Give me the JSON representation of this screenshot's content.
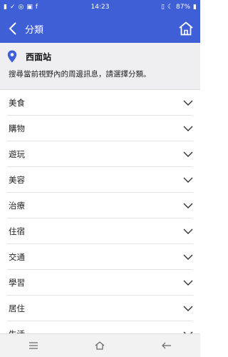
{
  "status_bar": {
    "time": "14:23",
    "battery": "87%",
    "icons_left": [
      "signal-icon",
      "check-icon",
      "wifi-icon",
      "photo-icon",
      "facebook-icon"
    ],
    "icons_right": [
      "vibrate-icon",
      "moon-icon",
      "battery-icon"
    ]
  },
  "app_bar": {
    "title": "分類"
  },
  "location": {
    "station": "西面站",
    "instruction": "搜尋當前視野內的周邊訊息，請選擇分類。"
  },
  "categories": [
    {
      "label": "美食"
    },
    {
      "label": "購物"
    },
    {
      "label": "遊玩"
    },
    {
      "label": "美容"
    },
    {
      "label": "治療"
    },
    {
      "label": "住宿"
    },
    {
      "label": "交通"
    },
    {
      "label": "學習"
    },
    {
      "label": "居住"
    },
    {
      "label": "生活"
    }
  ],
  "colors": {
    "accent": "#3f5fd6",
    "panel": "#efeff2"
  }
}
